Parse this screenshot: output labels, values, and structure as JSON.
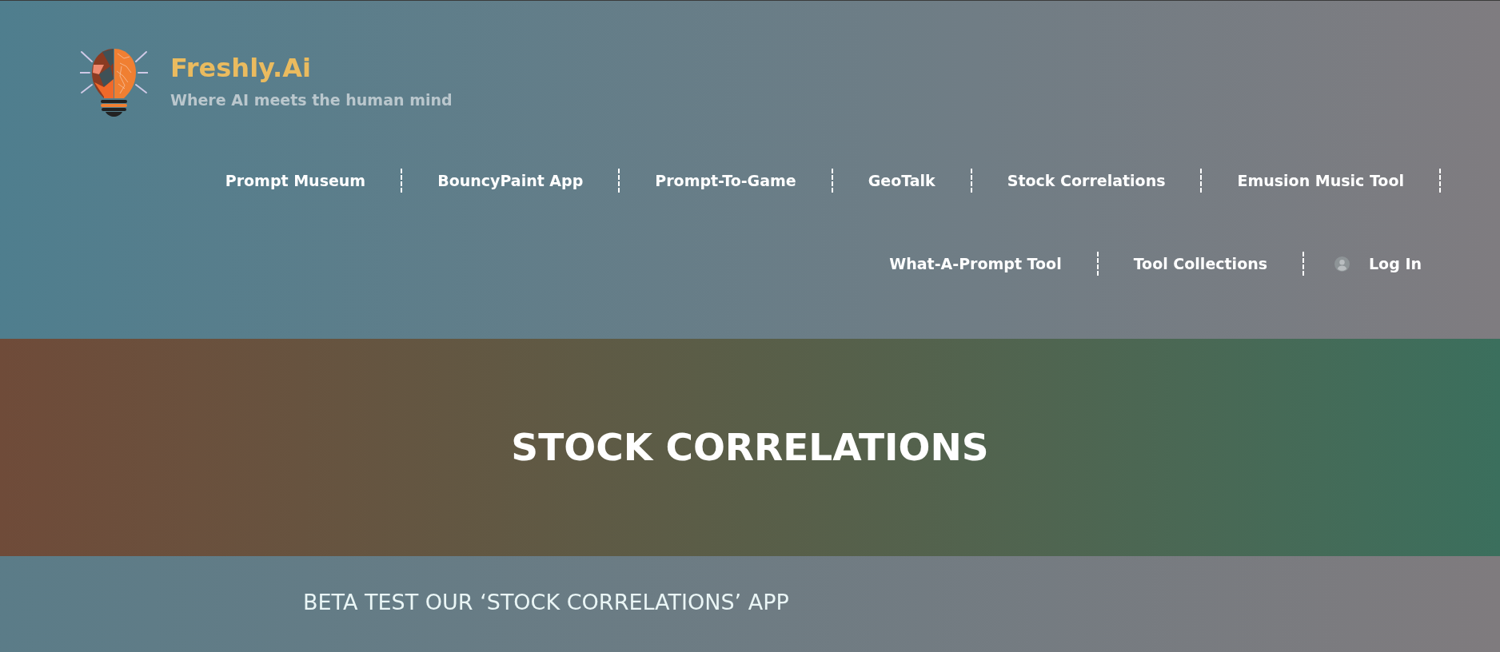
{
  "brand": {
    "name": "Freshly.Ai",
    "tagline": "Where AI meets the human mind"
  },
  "nav": {
    "rows": [
      {
        "links": [
          "Prompt Museum",
          "BouncyPaint App",
          "Prompt-To-Game",
          "GeoTalk",
          "Stock Correlations",
          "Emusion Music Tool"
        ]
      },
      {
        "links": [
          "What-A-Prompt Tool",
          "Tool Collections"
        ],
        "login": "Log In"
      }
    ]
  },
  "hero": {
    "title": "STOCK CORRELATIONS"
  },
  "section": {
    "heading": "BETA TEST OUR ‘STOCK CORRELATIONS’ APP"
  }
}
